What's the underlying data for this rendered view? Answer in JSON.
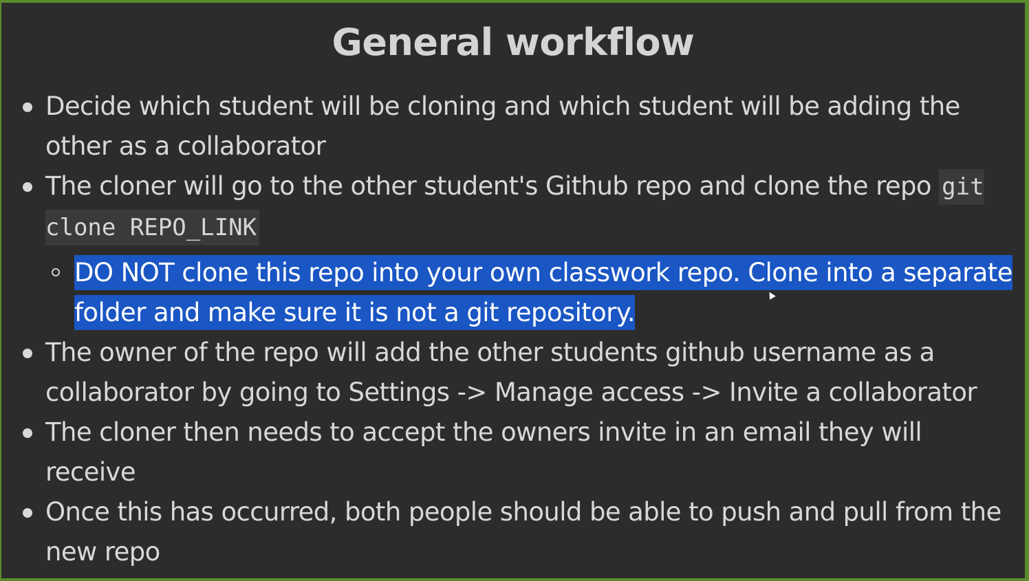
{
  "slide": {
    "title": "General workflow",
    "bullets": [
      {
        "text": "Decide which student will be cloning and which student will be adding the other as a collaborator"
      },
      {
        "text_before": "The cloner will go to the other student's Github repo and clone the repo ",
        "code": "git clone REPO_LINK"
      },
      {
        "sub": "DO NOT clone this repo into your own classwork repo. Clone into a separate folder and make sure it is not a git repository."
      },
      {
        "text": "The owner of the repo will add the other students github username as a collaborator by going to Settings -> Manage access -> Invite a collaborator"
      },
      {
        "text": "The cloner then needs to accept the owners invite in an email they will receive"
      },
      {
        "text": "Once this has occurred, both people should be able to push and pull from the new repo"
      }
    ]
  },
  "colors": {
    "background": "#2c2c2c",
    "frame_border": "#5a8c2e",
    "text": "#d8d8d8",
    "selection": "#1a56c4"
  }
}
